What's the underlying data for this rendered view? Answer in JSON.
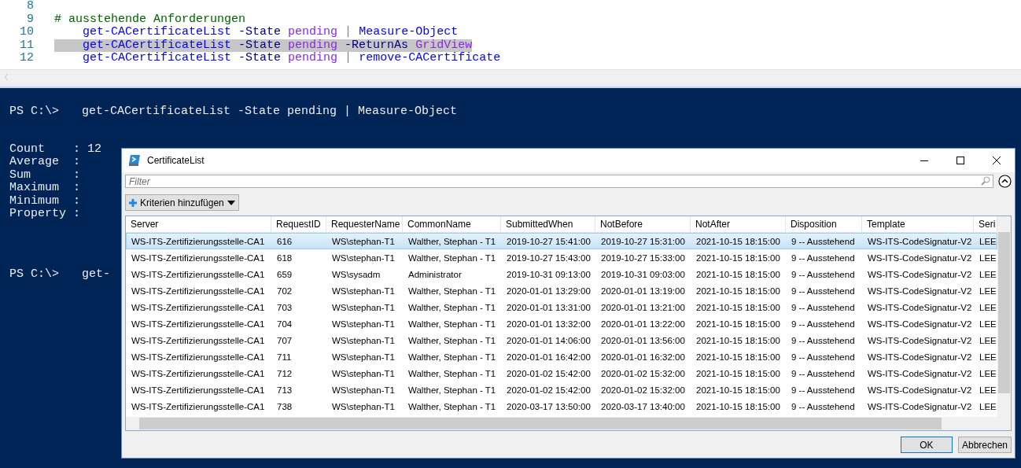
{
  "editor": {
    "lines": [
      {
        "number": "8"
      },
      {
        "number": "9",
        "highlighted": false,
        "tokens": [
          {
            "kind": "comment",
            "text": "# ausstehende Anforderungen"
          }
        ]
      },
      {
        "number": "10",
        "highlighted": false,
        "indent": true,
        "tokens": [
          {
            "kind": "command",
            "text": "get-CACertificateList"
          },
          {
            "kind": "param",
            "text": "-State"
          },
          {
            "kind": "value",
            "text": "pending"
          },
          {
            "kind": "pipe",
            "text": "|"
          },
          {
            "kind": "command",
            "text": "Measure-Object"
          }
        ]
      },
      {
        "number": "11",
        "highlighted": true,
        "indent": true,
        "tokens": [
          {
            "kind": "command",
            "text": "get-CACertificateList"
          },
          {
            "kind": "param",
            "text": "-State"
          },
          {
            "kind": "value",
            "text": "pending"
          },
          {
            "kind": "param",
            "text": "-ReturnAs"
          },
          {
            "kind": "value",
            "text": "GridView"
          }
        ]
      },
      {
        "number": "12",
        "highlighted": false,
        "indent": true,
        "tokens": [
          {
            "kind": "command",
            "text": "get-CACertificateList"
          },
          {
            "kind": "param",
            "text": "-State"
          },
          {
            "kind": "value",
            "text": "pending"
          },
          {
            "kind": "pipe",
            "text": "|"
          },
          {
            "kind": "command",
            "text": "remove-CACertificate"
          }
        ]
      }
    ]
  },
  "console": {
    "lines": [
      {
        "kind": "prompt",
        "prompt": "PS C:\\>",
        "command": "get-CACertificateList -State pending | Measure-Object"
      },
      {
        "kind": "output",
        "text": "Count    : 12"
      },
      {
        "kind": "output",
        "text": "Average  :"
      },
      {
        "kind": "output",
        "text": "Sum      :"
      },
      {
        "kind": "output",
        "text": "Maximum  :"
      },
      {
        "kind": "output",
        "text": "Minimum  :"
      },
      {
        "kind": "output",
        "text": "Property :"
      },
      {
        "kind": "prompt",
        "prompt": "PS C:\\>",
        "command": "get-"
      }
    ]
  },
  "dialog": {
    "title": "CertificateList",
    "filter": {
      "placeholder": "Filter"
    },
    "criteria_button": "Kriterien hinzufügen",
    "table": {
      "columns": [
        "Server",
        "RequestID",
        "RequesterName",
        "CommonName",
        "SubmittedWhen",
        "NotBefore",
        "NotAfter",
        "Disposition",
        "Template",
        "Seri"
      ],
      "rows": [
        {
          "selected": true,
          "cells": [
            "WS-ITS-Zertifizierungsstelle-CA1",
            "616",
            "WS\\stephan-T1",
            "Walther, Stephan - T1",
            "2019-10-27 15:41:00",
            "2019-10-27 15:31:00",
            "2021-10-15 18:15:00",
            "9 -- Ausstehend",
            "WS-ITS-CodeSignatur-V2",
            "LEE"
          ]
        },
        {
          "selected": false,
          "cells": [
            "WS-ITS-Zertifizierungsstelle-CA1",
            "618",
            "WS\\stephan-T1",
            "Walther, Stephan - T1",
            "2019-10-27 15:43:00",
            "2019-10-27 15:33:00",
            "2021-10-15 18:15:00",
            "9 -- Ausstehend",
            "WS-ITS-CodeSignatur-V2",
            "LEE"
          ]
        },
        {
          "selected": false,
          "cells": [
            "WS-ITS-Zertifizierungsstelle-CA1",
            "659",
            "WS\\sysadm",
            "Administrator",
            "2019-10-31 09:13:00",
            "2019-10-31 09:03:00",
            "2021-10-15 18:15:00",
            "9 -- Ausstehend",
            "WS-ITS-CodeSignatur-V2",
            "LEE"
          ]
        },
        {
          "selected": false,
          "cells": [
            "WS-ITS-Zertifizierungsstelle-CA1",
            "702",
            "WS\\stephan-T1",
            "Walther, Stephan - T1",
            "2020-01-01 13:29:00",
            "2020-01-01 13:19:00",
            "2021-10-15 18:15:00",
            "9 -- Ausstehend",
            "WS-ITS-CodeSignatur-V2",
            "LEE"
          ]
        },
        {
          "selected": false,
          "cells": [
            "WS-ITS-Zertifizierungsstelle-CA1",
            "703",
            "WS\\stephan-T1",
            "Walther, Stephan - T1",
            "2020-01-01 13:31:00",
            "2020-01-01 13:21:00",
            "2021-10-15 18:15:00",
            "9 -- Ausstehend",
            "WS-ITS-CodeSignatur-V2",
            "LEE"
          ]
        },
        {
          "selected": false,
          "cells": [
            "WS-ITS-Zertifizierungsstelle-CA1",
            "704",
            "WS\\stephan-T1",
            "Walther, Stephan - T1",
            "2020-01-01 13:32:00",
            "2020-01-01 13:22:00",
            "2021-10-15 18:15:00",
            "9 -- Ausstehend",
            "WS-ITS-CodeSignatur-V2",
            "LEE"
          ]
        },
        {
          "selected": false,
          "cells": [
            "WS-ITS-Zertifizierungsstelle-CA1",
            "707",
            "WS\\stephan-T1",
            "Walther, Stephan - T1",
            "2020-01-01 14:06:00",
            "2020-01-01 13:56:00",
            "2021-10-15 18:15:00",
            "9 -- Ausstehend",
            "WS-ITS-CodeSignatur-V2",
            "LEE"
          ]
        },
        {
          "selected": false,
          "cells": [
            "WS-ITS-Zertifizierungsstelle-CA1",
            "711",
            "WS\\stephan-T1",
            "Walther, Stephan - T1",
            "2020-01-01 16:42:00",
            "2020-01-01 16:32:00",
            "2021-10-15 18:15:00",
            "9 -- Ausstehend",
            "WS-ITS-CodeSignatur-V2",
            "LEE"
          ]
        },
        {
          "selected": false,
          "cells": [
            "WS-ITS-Zertifizierungsstelle-CA1",
            "712",
            "WS\\stephan-T1",
            "Walther, Stephan - T1",
            "2020-01-02 15:42:00",
            "2020-01-02 15:32:00",
            "2021-10-15 18:15:00",
            "9 -- Ausstehend",
            "WS-ITS-CodeSignatur-V2",
            "LEE"
          ]
        },
        {
          "selected": false,
          "cells": [
            "WS-ITS-Zertifizierungsstelle-CA1",
            "713",
            "WS\\stephan-T1",
            "Walther, Stephan - T1",
            "2020-01-02 15:42:00",
            "2020-01-02 15:32:00",
            "2021-10-15 18:15:00",
            "9 -- Ausstehend",
            "WS-ITS-CodeSignatur-V2",
            "LEE"
          ]
        },
        {
          "selected": false,
          "cells": [
            "WS-ITS-Zertifizierungsstelle-CA1",
            "738",
            "WS\\stephan-T1",
            "Walther, Stephan - T1",
            "2020-03-17 13:50:00",
            "2020-03-17 13:40:00",
            "2021-10-15 18:15:00",
            "9 -- Ausstehend",
            "WS-ITS-CodeSignatur-V2",
            "LEE"
          ]
        }
      ]
    },
    "buttons": [
      "OK",
      "Abbrechen"
    ]
  }
}
